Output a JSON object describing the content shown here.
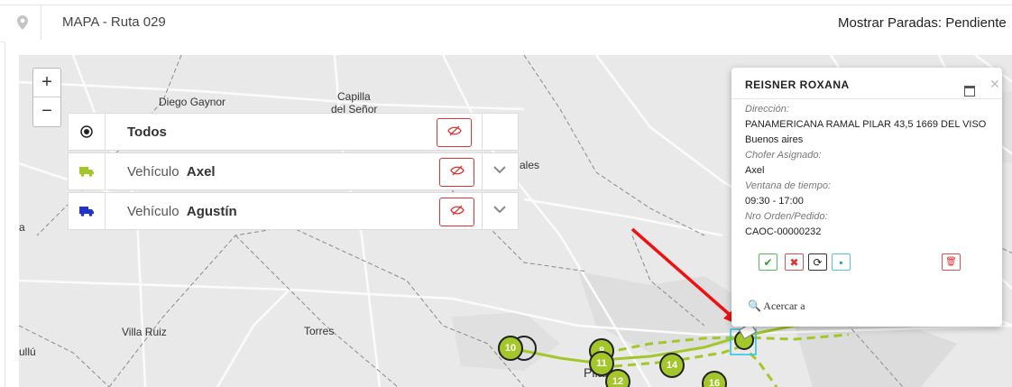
{
  "header": {
    "title": "MAPA - Ruta 029",
    "show_stops_label": "Mostrar Paradas: Pendiente",
    "icon": "map-pin-icon"
  },
  "map": {
    "zoom_in": "+",
    "zoom_out": "−",
    "places": {
      "diego_gaynor": "Diego Gaynor",
      "capilla_1": "Capilla",
      "capilla_2": "del Señor",
      "ales": "ales",
      "villa_ruiz": "Villa Ruiz",
      "torres": "Torres",
      "pilar": "Pilar",
      "a_edge": "a",
      "llu_edge": "ullú"
    },
    "clusters": [
      "10",
      "8",
      "11",
      "12",
      "14",
      "16"
    ]
  },
  "vehicles": {
    "all": {
      "label": "Todos",
      "icon": "radio-target-icon"
    },
    "rows": [
      {
        "prefix": "Vehículo",
        "name": "Axel",
        "color": "#a3c72a",
        "icon": "truck-icon"
      },
      {
        "prefix": "Vehículo",
        "name": "Agustín",
        "color": "#2233cc",
        "icon": "truck-icon"
      }
    ],
    "hide_icon": "eye-slash-icon",
    "expand_icon": "chevron-down-icon"
  },
  "popup": {
    "title": "REISNER ROXANA",
    "address_label": "Dirección:",
    "address": "PANAMERICANA RAMAL PILAR 43,5 1669 DEL VISO Buenos aires",
    "driver_label": "Chofer Asignado:",
    "driver": "Axel",
    "window_label": "Ventana de tiempo:",
    "window": "09:30 - 17:00",
    "order_label": "Nro Orden/Pedido:",
    "order": "CAOC-00000232",
    "zoom_link": "Acercar  a",
    "actions": {
      "confirm": "✔",
      "cancel": "✖",
      "reassign": "⟳",
      "note": "▪",
      "delete": "🗑"
    }
  },
  "colors": {
    "accent_green": "#a3c72a",
    "accent_blue": "#2233cc",
    "danger_red": "#dd3333",
    "arrow_red": "#ee1111"
  }
}
